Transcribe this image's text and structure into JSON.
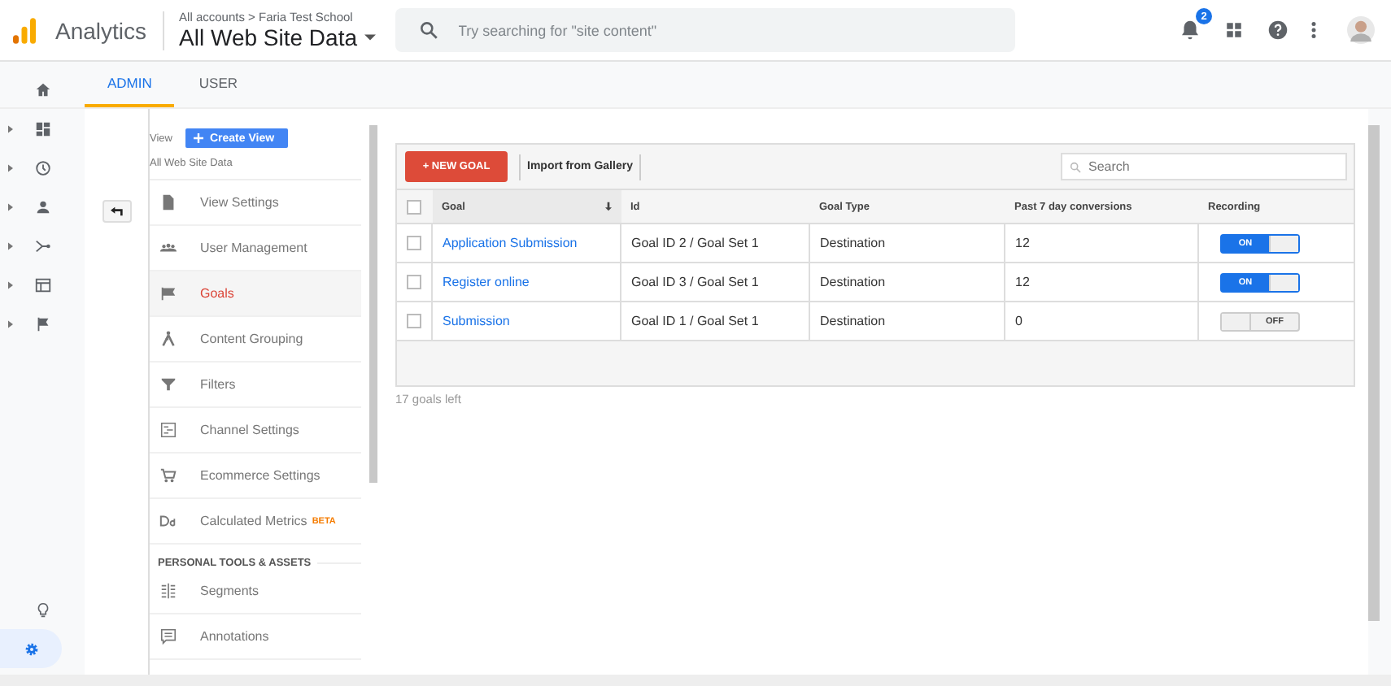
{
  "header": {
    "product": "Analytics",
    "breadcrumb": "All accounts > Faria Test School",
    "property": "All Web Site Data",
    "search_placeholder": "Try searching for \"site content\"",
    "notification_count": "2"
  },
  "tabs": [
    {
      "label": "ADMIN",
      "selected": true
    },
    {
      "label": "USER",
      "selected": false
    }
  ],
  "view": {
    "label": "View",
    "create_button": "Create View",
    "name": "All Web Site Data"
  },
  "menu": [
    {
      "label": "View Settings",
      "selected": false
    },
    {
      "label": "User Management",
      "selected": false
    },
    {
      "label": "Goals",
      "selected": true
    },
    {
      "label": "Content Grouping",
      "selected": false
    },
    {
      "label": "Filters",
      "selected": false
    },
    {
      "label": "Channel Settings",
      "selected": false
    },
    {
      "label": "Ecommerce Settings",
      "selected": false
    },
    {
      "label": "Calculated Metrics",
      "badge": "BETA",
      "selected": false
    }
  ],
  "section_title": "PERSONAL TOOLS & ASSETS",
  "section_menu": [
    {
      "label": "Segments",
      "selected": false
    },
    {
      "label": "Annotations",
      "selected": false
    }
  ],
  "toolbar": {
    "new_button": "+ NEW GOAL",
    "import_button": "Import from Gallery",
    "search_placeholder": "Search"
  },
  "table": {
    "select_all_checked": false,
    "columns": [
      "Goal",
      "Id",
      "Goal Type",
      "Past 7 day conversions",
      "Recording"
    ],
    "rows": [
      {
        "checked": false,
        "goal": "Application Submission",
        "id": "Goal ID 2 / Goal Set 1",
        "type": "Destination",
        "conversions": "12",
        "recording": {
          "on": true,
          "label": "ON"
        }
      },
      {
        "checked": false,
        "goal": "Register online",
        "id": "Goal ID 3 / Goal Set 1",
        "type": "Destination",
        "conversions": "12",
        "recording": {
          "on": true,
          "label": "ON"
        }
      },
      {
        "checked": false,
        "goal": "Submission",
        "id": "Goal ID 1 / Goal Set 1",
        "type": "Destination",
        "conversions": "0",
        "recording": {
          "on": false,
          "label": "OFF"
        }
      }
    ]
  },
  "footer_note": "17 goals left"
}
